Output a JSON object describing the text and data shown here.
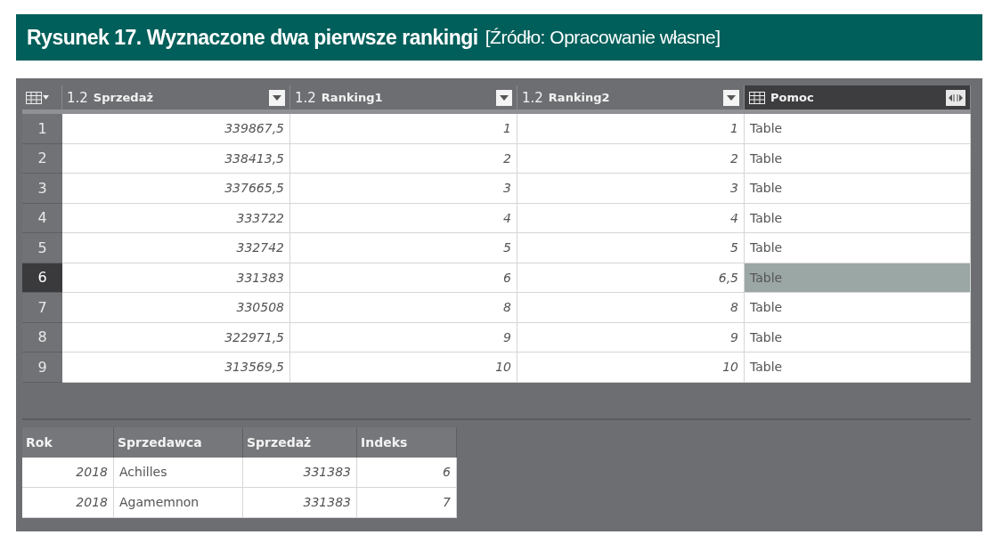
{
  "caption": {
    "title": "Rysunek 17. Wyznaczone dwa pierwsze rankingi",
    "source": "[Źródło: Opracowanie własne]"
  },
  "grid": {
    "columns": [
      {
        "kind": "number",
        "type_label": "1.2",
        "name": "Sprzedaż",
        "selected": false
      },
      {
        "kind": "number",
        "type_label": "1.2",
        "name": "Ranking1",
        "selected": false
      },
      {
        "kind": "number",
        "type_label": "1.2",
        "name": "Ranking2",
        "selected": false
      },
      {
        "kind": "table",
        "name": "Pomoc",
        "selected": true
      }
    ],
    "rows": [
      {
        "index": "1",
        "selected": false,
        "cells": [
          "339867,5",
          "1",
          "1",
          "Table"
        ]
      },
      {
        "index": "2",
        "selected": false,
        "cells": [
          "338413,5",
          "2",
          "2",
          "Table"
        ]
      },
      {
        "index": "3",
        "selected": false,
        "cells": [
          "337665,5",
          "3",
          "3",
          "Table"
        ]
      },
      {
        "index": "4",
        "selected": false,
        "cells": [
          "333722",
          "4",
          "4",
          "Table"
        ]
      },
      {
        "index": "5",
        "selected": false,
        "cells": [
          "332742",
          "5",
          "5",
          "Table"
        ]
      },
      {
        "index": "6",
        "selected": true,
        "cells": [
          "331383",
          "6",
          "6,5",
          "Table"
        ]
      },
      {
        "index": "7",
        "selected": false,
        "cells": [
          "330508",
          "8",
          "8",
          "Table"
        ]
      },
      {
        "index": "8",
        "selected": false,
        "cells": [
          "322971,5",
          "9",
          "9",
          "Table"
        ]
      },
      {
        "index": "9",
        "selected": false,
        "cells": [
          "313569,5",
          "10",
          "10",
          "Table"
        ]
      }
    ]
  },
  "preview": {
    "columns": [
      {
        "name": "Rok",
        "kind": "number"
      },
      {
        "name": "Sprzedawca",
        "kind": "text"
      },
      {
        "name": "Sprzedaż",
        "kind": "number"
      },
      {
        "name": "Indeks",
        "kind": "number"
      }
    ],
    "rows": [
      [
        "2018",
        "Achilles",
        "331383",
        "6"
      ],
      [
        "2018",
        "Agamemnon",
        "331383",
        "7"
      ]
    ]
  }
}
